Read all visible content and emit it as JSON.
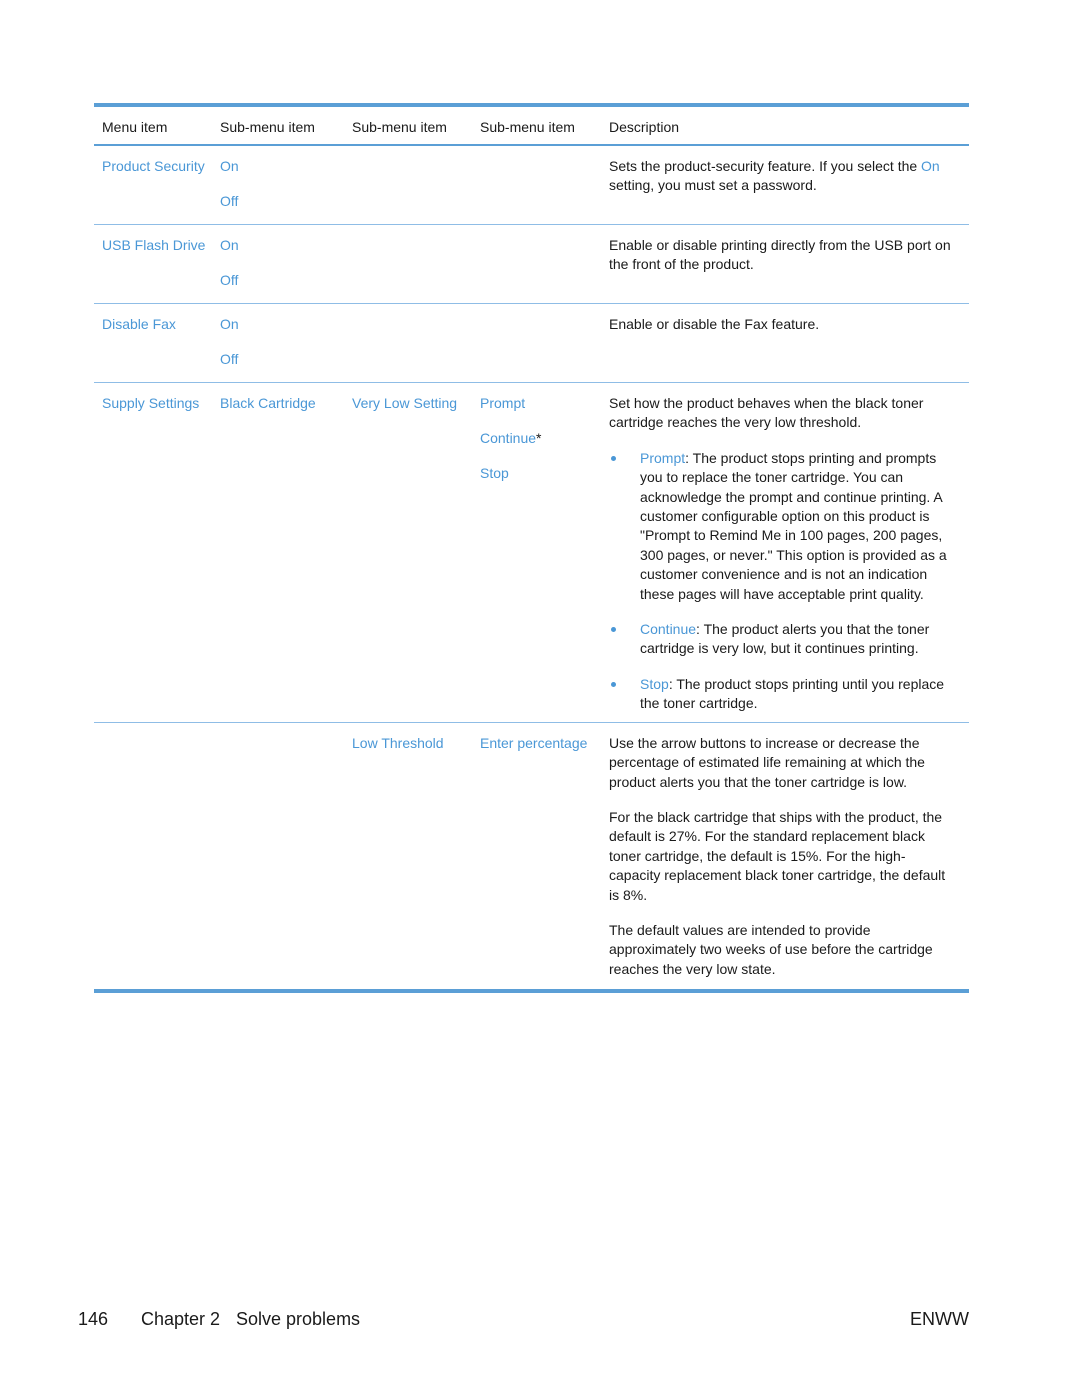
{
  "table": {
    "headers": [
      "Menu item",
      "Sub-menu item",
      "Sub-menu item",
      "Sub-menu item",
      "Description"
    ],
    "rows": [
      {
        "menu": "Product Security",
        "sub1": [
          "On",
          "Off"
        ],
        "desc_pre": "Sets the product-security feature. If you select the ",
        "desc_link": "On",
        "desc_post": " setting, you must set a password."
      },
      {
        "menu": "USB Flash Drive",
        "sub1": [
          "On",
          "Off"
        ],
        "desc": "Enable or disable printing directly from the USB port on the front of the product."
      },
      {
        "menu": "Disable Fax",
        "sub1": [
          "On",
          "Off"
        ],
        "desc": "Enable or disable the Fax feature."
      },
      {
        "menu": "Supply Settings",
        "sub1": "Black Cartridge",
        "sub2": "Very Low Setting",
        "sub3": [
          "Prompt",
          "Continue",
          "Stop"
        ],
        "default_marker": "*",
        "desc_intro": "Set how the product behaves when the black toner cartridge reaches the very low threshold.",
        "bullets": [
          {
            "term": "Prompt",
            "text": ": The product stops printing and prompts you to replace the toner cartridge. You can acknowledge the prompt and continue printing. A customer configurable option on this product is \"Prompt to Remind Me in 100 pages, 200 pages, 300 pages, or never.\" This option is provided as a customer convenience and is not an indication these pages will have acceptable print quality."
          },
          {
            "term": "Continue",
            "text": ": The product alerts you that the toner cartridge is very low, but it continues printing."
          },
          {
            "term": "Stop",
            "text": ": The product stops printing until you replace the toner cartridge."
          }
        ]
      },
      {
        "sub2": "Low Threshold",
        "sub3": "Enter percentage",
        "desc_paragraphs": [
          "Use the arrow buttons to increase or decrease the percentage of estimated life remaining at which the product alerts you that the toner cartridge is low.",
          "For the black cartridge that ships with the product, the default is 27%. For the standard replacement black toner cartridge, the default is 15%. For the high-capacity replacement black toner cartridge, the default is 8%.",
          "The default values are intended to provide approximately two weeks of use before the cartridge reaches the very low state."
        ]
      }
    ]
  },
  "footer": {
    "page_number": "146",
    "chapter": "Chapter 2",
    "chapter_title": "Solve problems",
    "locale": "ENWW"
  },
  "colors": {
    "accent": "#4a97d6",
    "rule": "#5b9fd6"
  }
}
